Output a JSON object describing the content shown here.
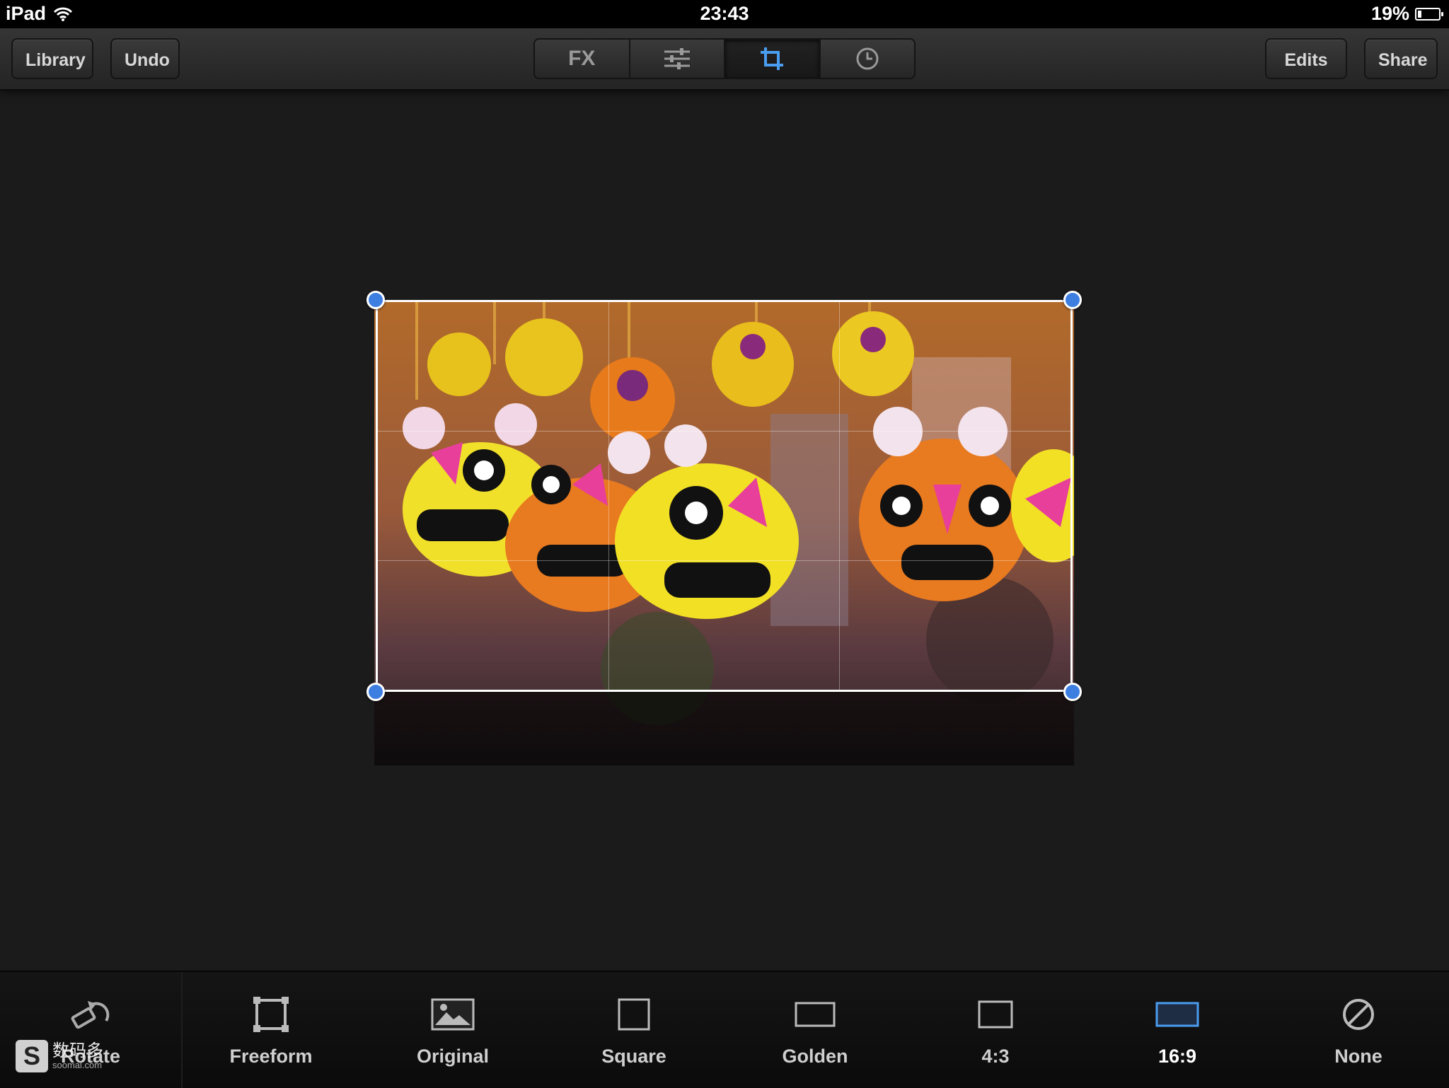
{
  "status_bar": {
    "device": "iPad",
    "time": "23:43",
    "battery": "19%",
    "battery_level": 0.19
  },
  "toolbar": {
    "library_label": "Library",
    "undo_label": "Undo",
    "fx_label": "FX",
    "edits_label": "Edits",
    "share_label": "Share",
    "active_tool": "crop",
    "accent_color": "#4a9df0"
  },
  "canvas": {
    "handle_color": "#3d7fe0",
    "frame_color": "#ffffff"
  },
  "crop_bar": {
    "rotate_label": "Rotate",
    "items": [
      {
        "label": "Freeform",
        "icon": "freeform-icon"
      },
      {
        "label": "Original",
        "icon": "original-photo-icon"
      },
      {
        "label": "Square",
        "icon": "square-icon"
      },
      {
        "label": "Golden",
        "icon": "golden-ratio-icon"
      },
      {
        "label": "4:3",
        "icon": "ratio-4-3-icon"
      },
      {
        "label": "16:9",
        "icon": "ratio-16-9-icon",
        "selected": true
      },
      {
        "label": "None",
        "icon": "none-icon"
      }
    ]
  },
  "watermark": {
    "text": "数码多",
    "site": "soomal.com"
  }
}
